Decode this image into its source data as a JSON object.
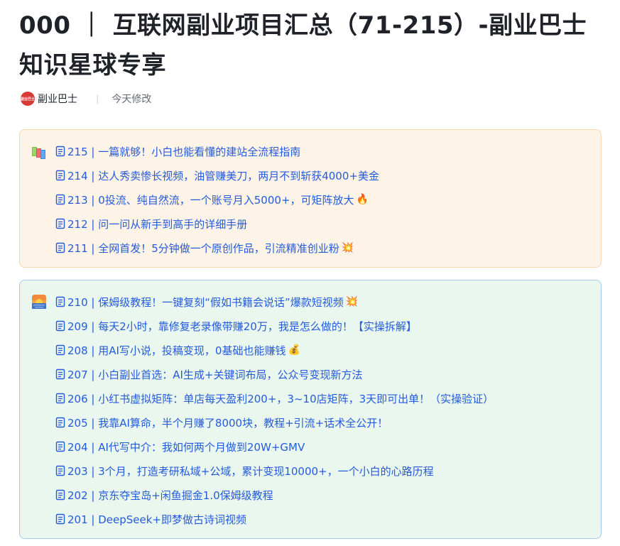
{
  "page": {
    "title": "000 ｜ 互联网副业项目汇总（71-215）-副业巴士知识星球专享",
    "author": "副业巴士",
    "avatar_text": "副业巴士",
    "modified": "今天修改",
    "separator": "|"
  },
  "colors": {
    "link": "#245bdb",
    "callout_orange_bg": "#fef3e7",
    "callout_green_bg": "#eaf7ee",
    "avatar_red": "#d83a35"
  },
  "callouts": [
    {
      "icon": "books-icon",
      "items": [
        {
          "text": "215 | 一篇就够！小白也能看懂的建站全流程指南",
          "emoji": ""
        },
        {
          "text": "214 | 达人秀卖惨长视频，油管赚美刀，两月不到斩获4000+美金",
          "emoji": ""
        },
        {
          "text": "213 | 0投流、纯自然流，一个账号月入5000+，可矩阵放大",
          "emoji": "🔥"
        },
        {
          "text": "212 | 问一问从新手到高手的详细手册",
          "emoji": ""
        },
        {
          "text": "211 | 全网首发！5分钟做一个原创作品，引流精准创业粉",
          "emoji": "💥"
        }
      ]
    },
    {
      "icon": "sunrise-icon",
      "items": [
        {
          "text": "210 | 保姆级教程！一键复刻“假如书籍会说话”爆款短视频",
          "emoji": "💥"
        },
        {
          "text": "209 | 每天2小时，靠修复老录像带赚20万，我是怎么做的！【实操拆解】",
          "emoji": ""
        },
        {
          "text": "208 | 用AI写小说，投稿变现，0基础也能赚钱",
          "emoji": "💰"
        },
        {
          "text": "207 | 小白副业首选：AI生成+关键词布局，公众号变现新方法",
          "emoji": ""
        },
        {
          "text": "206 | 小红书虚拟矩阵：单店每天盈利200+，3~10店矩阵，3天即可出单！（实操验证）",
          "emoji": ""
        },
        {
          "text": "205 | 我靠AI算命，半个月赚了8000块，教程+引流+话术全公开！",
          "emoji": ""
        },
        {
          "text": "204 | AI代写中介：我如何两个月做到20W+GMV",
          "emoji": ""
        },
        {
          "text": "203 | 3个月，打造考研私域+公域，累计变现10000+，一个小白的心路历程",
          "emoji": ""
        },
        {
          "text": "202 | 京东夺宝岛+闲鱼掘金1.0保姆级教程",
          "emoji": ""
        },
        {
          "text": "201 | DeepSeek+即梦做古诗词视频",
          "emoji": ""
        }
      ]
    }
  ]
}
